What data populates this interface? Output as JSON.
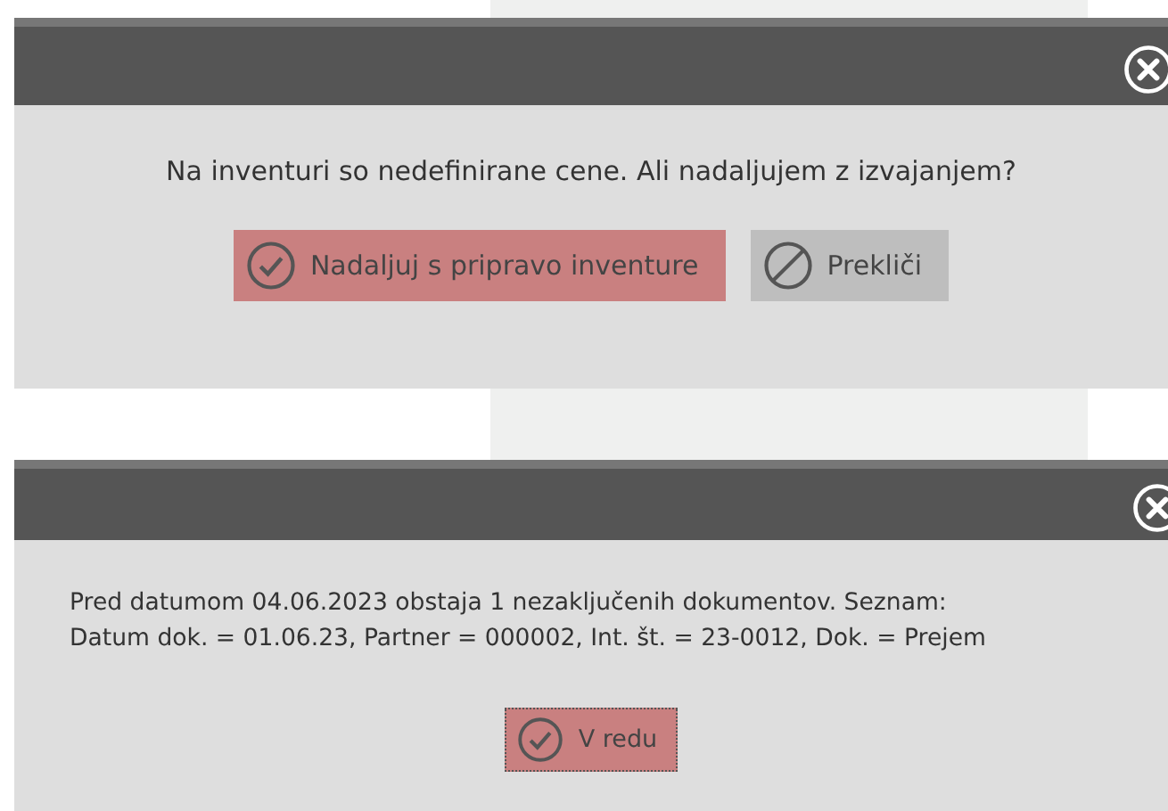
{
  "dialogs": [
    {
      "message_lines": [
        "Na inventuri so nedefinirane cene. Ali nadaljujem z izvajanjem?"
      ],
      "kind": "question",
      "buttons": [
        {
          "label": "Nadaljuj s pripravo inventure",
          "kind": "confirm",
          "focused": false
        },
        {
          "label": "Prekliči",
          "kind": "cancel",
          "focused": false
        }
      ]
    },
    {
      "message_lines": [
        "Pred datumom 04.06.2023 obstaja 1 nezaključenih dokumentov. Seznam:",
        "Datum dok. = 01.06.23, Partner = 000002, Int. št. = 23-0012, Dok. = Prejem"
      ],
      "kind": "notice",
      "buttons": [
        {
          "label": "V redu",
          "kind": "confirm",
          "focused": true
        }
      ]
    }
  ]
}
